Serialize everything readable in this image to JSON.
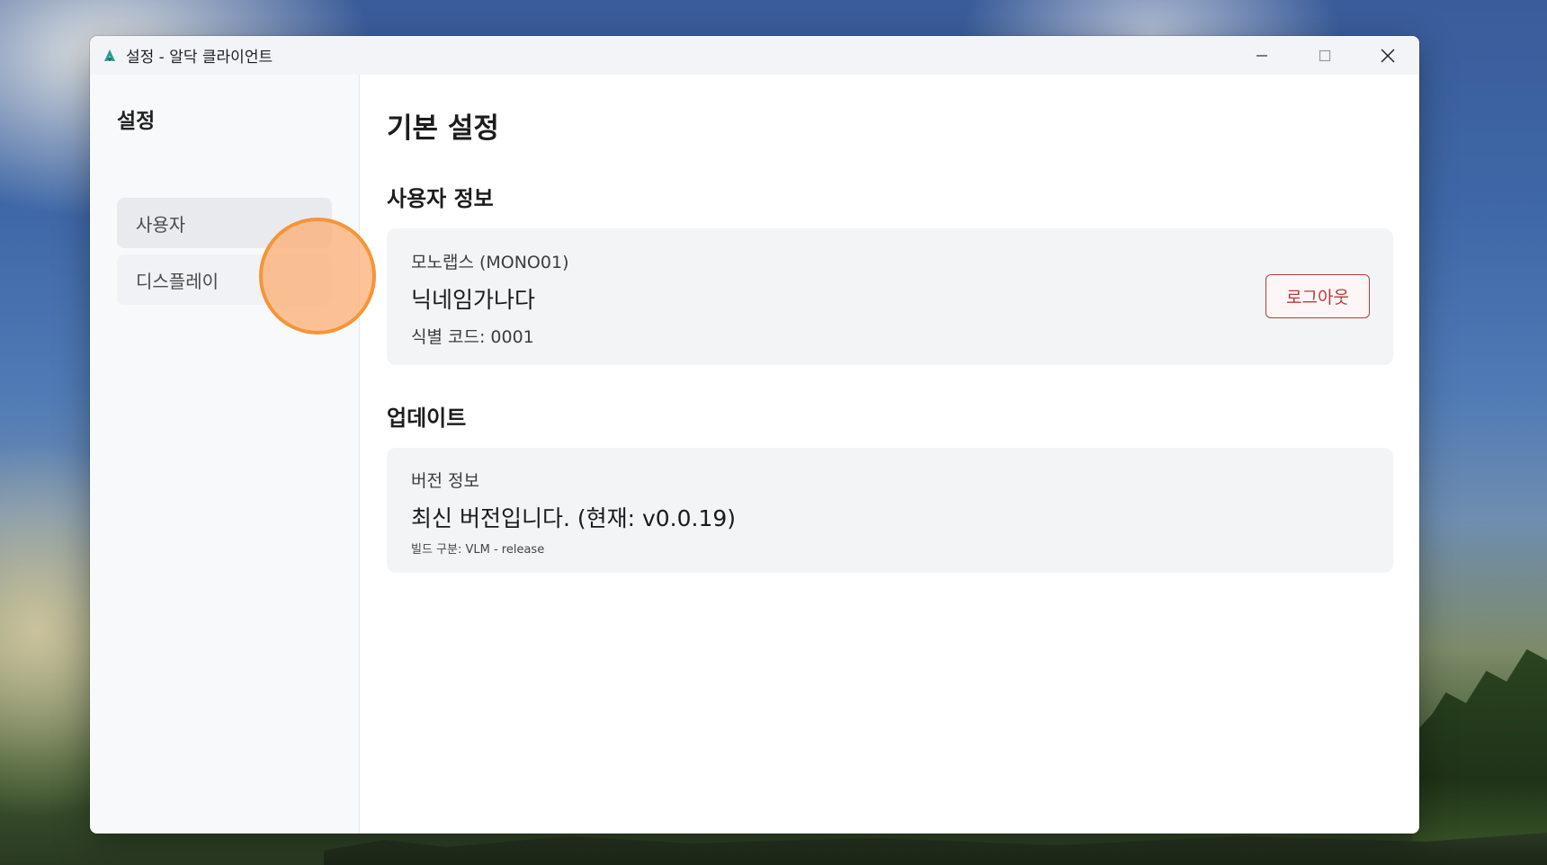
{
  "window": {
    "title": "설정 - 알닥 클라이언트",
    "accent": "#2a9d8f"
  },
  "sidebar": {
    "title": "설정",
    "items": [
      {
        "label": "사용자",
        "active": true
      },
      {
        "label": "디스플레이",
        "active": false
      }
    ]
  },
  "main": {
    "page_title": "기본 설정",
    "user_section": {
      "title": "사용자 정보",
      "organization": "모노랩스 (MONO01)",
      "nickname": "닉네임가나다",
      "id_code": "식별 코드: 0001",
      "logout_label": "로그아웃",
      "logout_color": "#b83a3a"
    },
    "update_section": {
      "title": "업데이트",
      "version_heading": "버전 정보",
      "version_status": "최신 버전입니다. (현재: v0.0.19)",
      "build_info": "빌드 구분: VLM - release"
    }
  },
  "icons": {
    "app": "aldak-logo-icon",
    "minimize": "minimize-icon",
    "maximize": "maximize-icon",
    "close": "close-icon"
  }
}
